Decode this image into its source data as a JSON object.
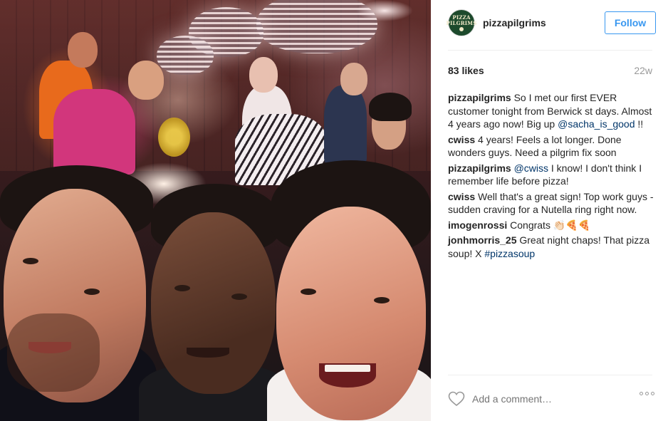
{
  "post": {
    "image_alt": "Selfie of three men at a pizza restaurant event",
    "header": {
      "username": "pizzapilgrims",
      "avatar_text_line1": "PIZZA",
      "avatar_text_line2": "PILGRIMS",
      "follow_label": "Follow"
    },
    "likes": "83 likes",
    "age": "22w",
    "comments": [
      {
        "author": "pizzapilgrims",
        "text": "So I met our first EVER customer tonight from Berwick st days. Almost 4 years ago now! Big up ",
        "mention": "@sacha_is_good",
        "after": " !!"
      },
      {
        "author": "cwiss",
        "text": "4 years! Feels a lot longer. Done wonders guys. Need a pilgrim fix soon",
        "mention": "",
        "after": ""
      },
      {
        "author": "pizzapilgrims",
        "text": "",
        "mention": "@cwiss",
        "after": " I know! I don't think I remember life before pizza!"
      },
      {
        "author": "cwiss",
        "text": "Well that's a great sign! Top work guys - sudden craving for a Nutella ring right now.",
        "mention": "",
        "after": ""
      },
      {
        "author": "imogenrossi",
        "text": "Congrats 👏🏻🍕🍕",
        "mention": "",
        "after": ""
      },
      {
        "author": "jonhmorris_25",
        "text": "Great night chaps! That pizza soup! X ",
        "mention": "#pizzasoup",
        "after": ""
      }
    ],
    "footer": {
      "heart_icon": "heart-outline-icon",
      "add_comment_placeholder": "Add a comment…",
      "more_icon": "more-options-icon"
    }
  },
  "colors": {
    "accent": "#3897f0",
    "link": "#003569",
    "muted": "#999999",
    "text": "#262626",
    "avatar_bg": "#1d4a2c"
  }
}
